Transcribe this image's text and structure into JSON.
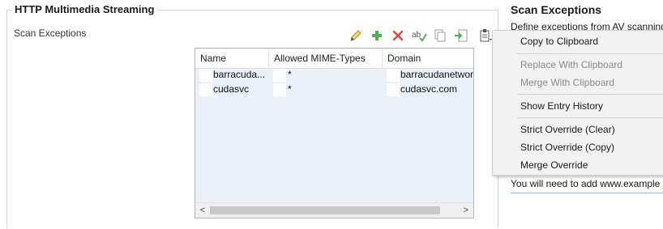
{
  "group": {
    "title": "HTTP Multimedia Streaming",
    "field_label": "Scan Exceptions"
  },
  "toolbar": {
    "icons": [
      "pencil-icon",
      "plus-icon",
      "delete-x-icon",
      "spellcheck-icon",
      "copy-icon",
      "import-icon",
      "clipboard-menu-icon"
    ]
  },
  "table": {
    "columns": [
      "Name",
      "Allowed MIME-Types",
      "Domain"
    ],
    "rows": [
      {
        "name": "barracuda...",
        "mime": "*",
        "domain": "barracudanetworks"
      },
      {
        "name": "cudasvc",
        "mime": "*",
        "domain": "cudasvc.com"
      }
    ],
    "scroll_left": "<",
    "scroll_right": ">"
  },
  "help": {
    "title": "Scan Exceptions",
    "text": "Define exceptions from AV scanning",
    "text2": "You will need to add www.example"
  },
  "menu": {
    "copy": "Copy to Clipboard",
    "replace": "Replace With Clipboard",
    "merge": "Merge With Clipboard",
    "history": "Show Entry History",
    "strict_clear": "Strict Override (Clear)",
    "strict_copy": "Strict Override (Copy)",
    "merge_override": "Merge Override"
  },
  "colors": {
    "table_bg": "#eaf1fb",
    "menu_bg": "#f2f2f2",
    "plus_green": "#4caf50",
    "delete_red": "#e0463c",
    "pencil_yellow": "#e0b03a"
  }
}
